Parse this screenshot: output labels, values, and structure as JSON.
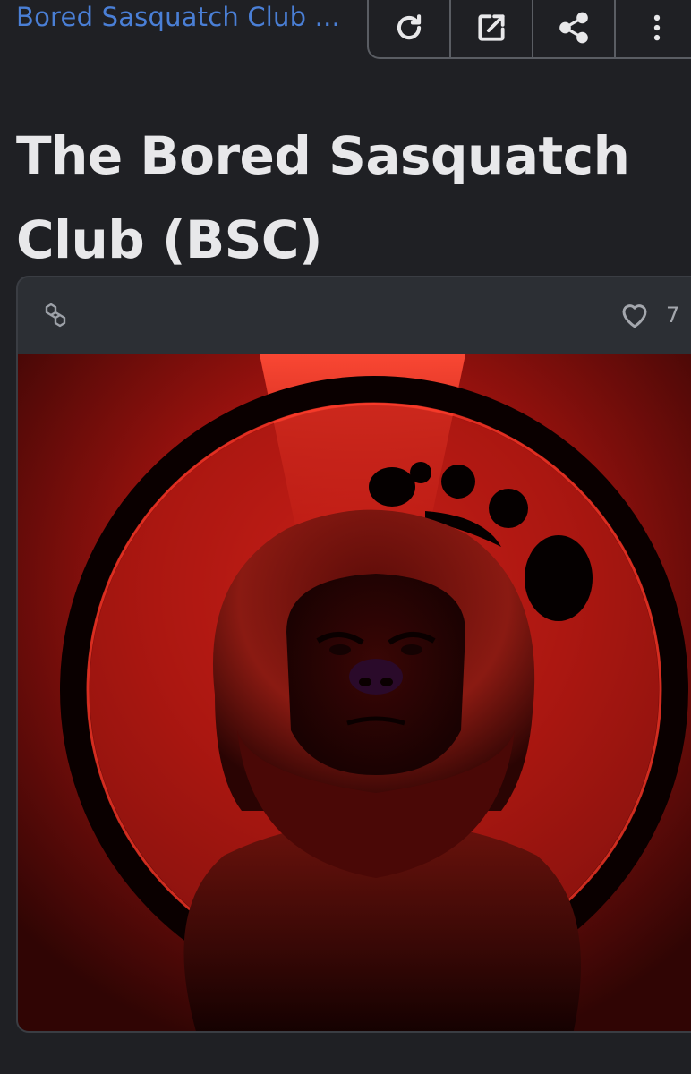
{
  "header": {
    "collection_link": "Bored Sasquatch Club ...",
    "actions": [
      {
        "name": "refresh-icon"
      },
      {
        "name": "external-link-icon"
      },
      {
        "name": "share-icon"
      },
      {
        "name": "more-vertical-icon"
      }
    ]
  },
  "item": {
    "title": "The Bored Sasquatch Club (BSC)"
  },
  "card": {
    "chain_icon": "polygon-chain-icon",
    "favorites_count": "7",
    "artwork": "sasquatch-red-portrait"
  },
  "colors": {
    "background": "#1f2024",
    "card": "#2c2f34",
    "link": "#4a7fd6",
    "art_red": "#e0281c"
  }
}
